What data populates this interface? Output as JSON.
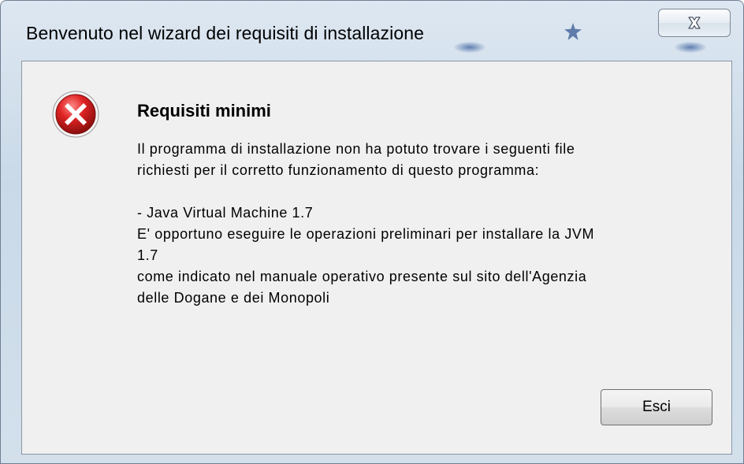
{
  "window": {
    "title": "Benvenuto nel wizard dei requisiti di installazione",
    "close_icon": "close-icon"
  },
  "dialog": {
    "icon": "error-icon",
    "heading": "Requisiti minimi",
    "message_lines": [
      "Il programma di installazione non ha potuto trovare i seguenti file",
      "richiesti per il corretto funzionamento di questo programma:",
      "",
      "- Java Virtual Machine 1.7",
      "E' opportuno eseguire le operazioni preliminari per installare la JVM",
      "1.7",
      "come indicato nel manuale operativo presente sul sito dell'Agenzia",
      "delle Dogane e dei Monopoli"
    ],
    "exit_button_label": "Esci"
  },
  "colors": {
    "error_red": "#c8102e",
    "client_bg": "#f0f0f0",
    "frame_blue": "#c9d9e8"
  }
}
